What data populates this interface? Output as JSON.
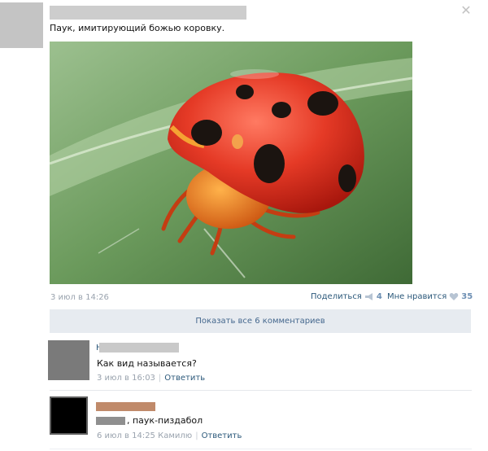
{
  "post": {
    "text": "Паук, имитирующий божью коровку.",
    "date": "3 июл в 14:26",
    "share_label": "Поделиться",
    "share_count": "4",
    "like_label": "Мне нравится",
    "like_count": "35",
    "close_icon": "close-icon"
  },
  "show_all_comments": "Показать все 6 комментариев",
  "comments": [
    {
      "name_prefix": "Н",
      "text": "Как вид называется?",
      "date": "3 июл в 16:03",
      "reply": "Ответить"
    },
    {
      "text": ", паук-пиздабол",
      "date": "6 июл в 14:25 Камилю",
      "reply": "Ответить"
    }
  ],
  "colors": {
    "link": "#2b587a",
    "muted": "#9aa3ae",
    "show_all_bg": "#e7ebf0"
  }
}
